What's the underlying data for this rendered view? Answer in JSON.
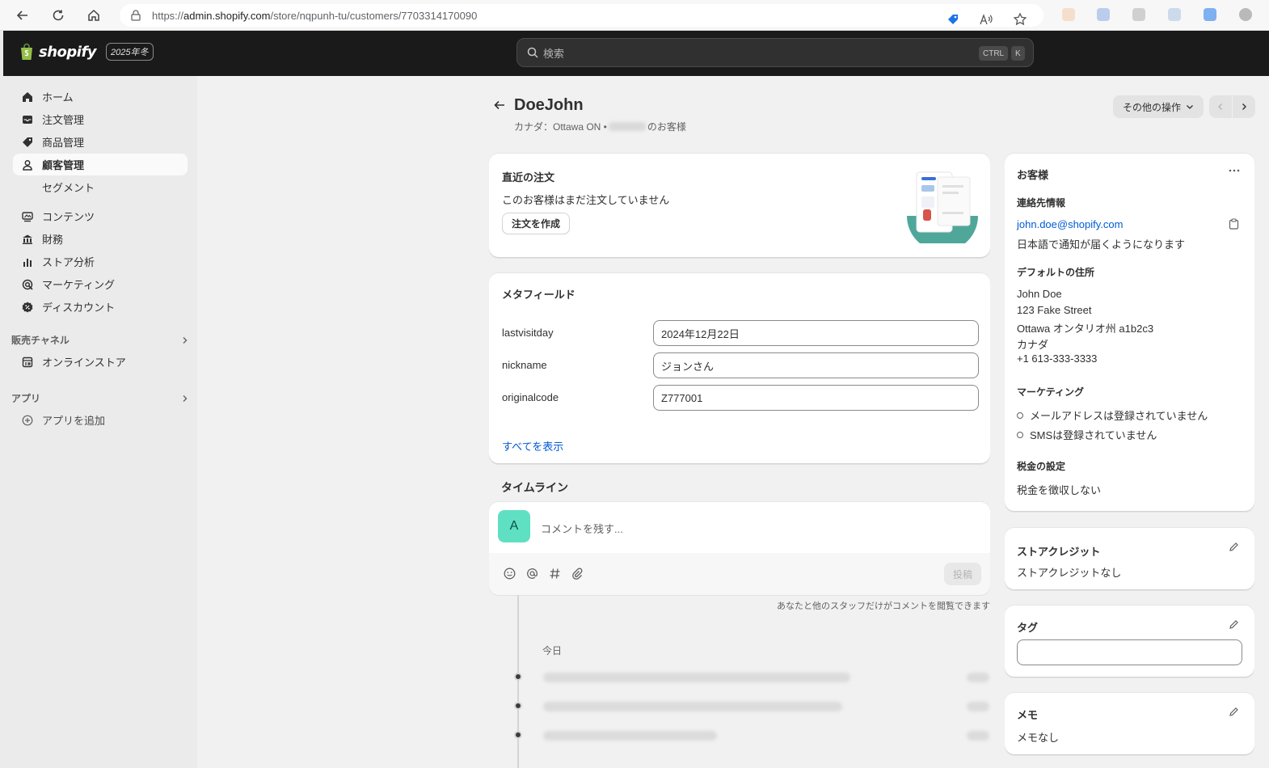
{
  "browser": {
    "url_prefix": "https://",
    "url_host": "admin.shopify.com",
    "url_path": "/store/nqpunh-tu/customers/7703314170090"
  },
  "topbar": {
    "logo_text": "shopify",
    "edition_badge": "2025年冬",
    "search_placeholder": "検索",
    "shortcut_ctrl": "CTRL",
    "shortcut_key": "K"
  },
  "sidebar": {
    "items": [
      {
        "label": "ホーム",
        "icon": "home-icon"
      },
      {
        "label": "注文管理",
        "icon": "inbox-icon"
      },
      {
        "label": "商品管理",
        "icon": "tag-icon"
      },
      {
        "label": "顧客管理",
        "icon": "person-icon",
        "active": true
      },
      {
        "label": "セグメント",
        "sub": true
      },
      {
        "label": "コンテンツ",
        "icon": "content-icon"
      },
      {
        "label": "財務",
        "icon": "bank-icon"
      },
      {
        "label": "ストア分析",
        "icon": "bar-chart-icon"
      },
      {
        "label": "マーケティング",
        "icon": "target-icon"
      },
      {
        "label": "ディスカウント",
        "icon": "discount-icon"
      }
    ],
    "sales_channels_label": "販売チャネル",
    "online_store_label": "オンラインストア",
    "apps_label": "アプリ",
    "add_app_label": "アプリを追加"
  },
  "page": {
    "title": "DoeJohn",
    "subtitle_prefix": "カナダ：Ottawa ON •",
    "subtitle_suffix": "のお客様",
    "more_actions_label": "その他の操作"
  },
  "recent_orders": {
    "title": "直近の注文",
    "message": "このお客様はまだ注文していません",
    "create_order_label": "注文を作成"
  },
  "metafields": {
    "title": "メタフィールド",
    "fields": [
      {
        "label": "lastvisitday",
        "value": "2024年12月22日"
      },
      {
        "label": "nickname",
        "value": "ジョンさん"
      },
      {
        "label": "originalcode",
        "value": "Z777001"
      }
    ],
    "show_all_label": "すべてを表示"
  },
  "timeline": {
    "title": "タイムライン",
    "avatar_letter": "A",
    "comment_placeholder": "コメントを残す...",
    "post_label": "投稿",
    "visibility_note": "あなたと他のスタッフだけがコメントを閲覧できます",
    "today_label": "今日"
  },
  "customer_card": {
    "title": "お客様",
    "contact_heading": "連絡先情報",
    "email": "john.doe@shopify.com",
    "notify_language": "日本語で通知が届くようになります",
    "address_heading": "デフォルトの住所",
    "address_lines": [
      "John Doe",
      "123 Fake Street",
      "Ottawa オンタリオ州 a1b2c3",
      "カナダ",
      "+1 613-333-3333"
    ],
    "marketing_heading": "マーケティング",
    "marketing_email": "メールアドレスは登録されていません",
    "marketing_sms": "SMSは登録されていません",
    "tax_heading": "税金の設定",
    "tax_value": "税金を徴収しない"
  },
  "store_credit": {
    "title": "ストアクレジット",
    "value": "ストアクレジットなし"
  },
  "tags": {
    "title": "タグ",
    "input_value": ""
  },
  "notes": {
    "title": "メモ",
    "value": "メモなし"
  },
  "colors": {
    "avatar": "#5fe0c3",
    "link": "#005bd3",
    "topbar": "#1a1a1a"
  }
}
